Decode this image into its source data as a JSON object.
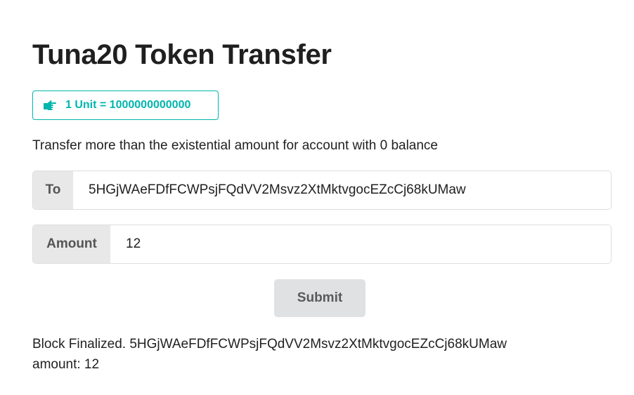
{
  "title": "Tuna20 Token Transfer",
  "unit": {
    "icon": "hand-point-right-icon",
    "text": "1 Unit = 1000000000000",
    "color": "#00b5ad"
  },
  "description": "Transfer more than the existential amount for account with 0 balance",
  "form": {
    "to": {
      "label": "To",
      "value": "5HGjWAeFDfFCWPsjFQdVV2Msvz2XtMktvgocEZcCj68kUMaw"
    },
    "amount": {
      "label": "Amount",
      "value": "12"
    },
    "submit_label": "Submit"
  },
  "status": {
    "line1": "Block Finalized. 5HGjWAeFDfFCWPsjFQdVV2Msvz2XtMktvgocEZcCj68kUMaw",
    "line2": "amount: 12"
  }
}
